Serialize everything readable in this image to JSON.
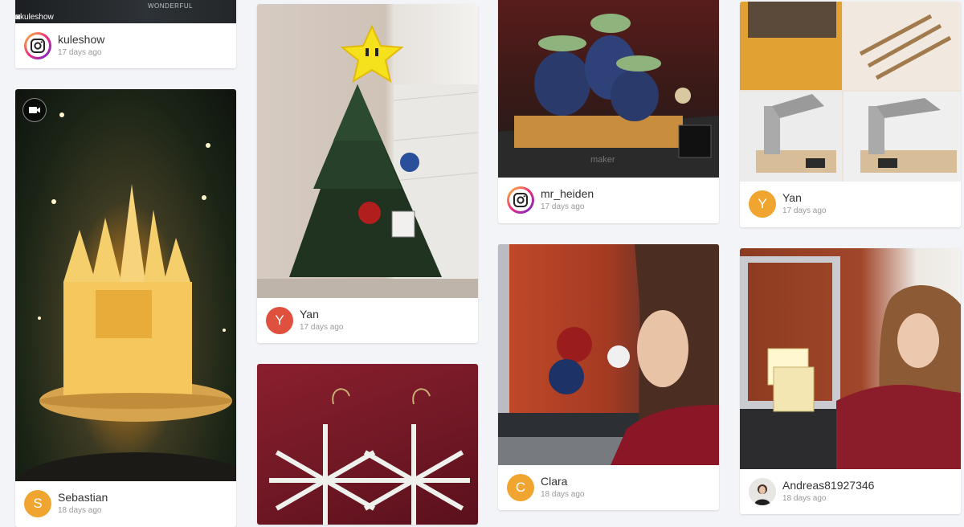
{
  "colors": {
    "avatar_red": "#e0503f",
    "avatar_orange": "#f0a531",
    "page_bg": "#f3f4f7"
  },
  "cards": [
    {
      "id": "kuleshow",
      "user": "kuleshow",
      "time": "17 days ago",
      "avatar": "instagram-icon",
      "watermark": "kuleshow",
      "image_text": "WONDERFUL"
    },
    {
      "id": "sebastian",
      "user": "Sebastian",
      "time": "18 days ago",
      "avatar_letter": "S",
      "media_icon": "video-camera-icon"
    },
    {
      "id": "yan1",
      "user": "Yan",
      "time": "17 days ago",
      "avatar_letter": "Y"
    },
    {
      "id": "earrings"
    },
    {
      "id": "mr_heiden",
      "user": "mr_heiden",
      "time": "17 days ago",
      "avatar": "instagram-icon",
      "image_text": "maker"
    },
    {
      "id": "clara",
      "user": "Clara",
      "time": "18 days ago",
      "avatar_letter": "C"
    },
    {
      "id": "yan2",
      "user": "Yan",
      "time": "17 days ago",
      "avatar_letter": "Y"
    },
    {
      "id": "andreas",
      "user": "Andreas81927346",
      "time": "18 days ago",
      "avatar": "profile-photo"
    }
  ]
}
